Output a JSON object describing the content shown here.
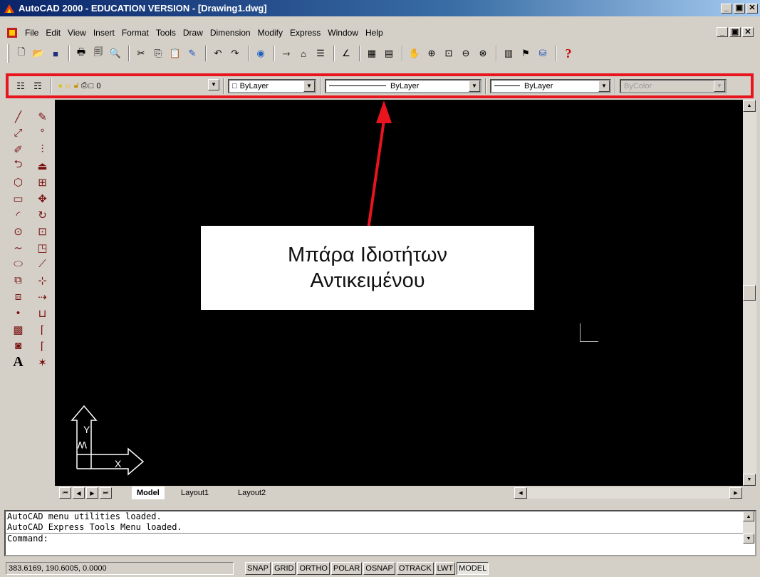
{
  "window": {
    "title": "AutoCAD 2000 - EDUCATION VERSION - [Drawing1.dwg]",
    "minimize": "_",
    "restore": "&#9635;",
    "close": "×"
  },
  "menu": [
    "File",
    "Edit",
    "View",
    "Insert",
    "Format",
    "Tools",
    "Draw",
    "Dimension",
    "Modify",
    "Express",
    "Window",
    "Help"
  ],
  "standard_toolbar": {
    "icons": [
      "new-icon",
      "open-icon",
      "save-icon",
      "print-icon",
      "print-preview-icon",
      "find-icon",
      "cut-icon",
      "copy-icon",
      "paste-icon",
      "match-properties-icon",
      "undo-icon",
      "redo-icon",
      "web-icon",
      "snap-from-icon",
      "block-icon",
      "properties-icon",
      "distance-icon",
      "design-center-icon",
      "adcenter-icon",
      "pan-icon",
      "zoom-realtime-icon",
      "zoom-window-icon",
      "zoom-previous-icon",
      "aerial-view-icon",
      "named-views-icon",
      "layer-icon",
      "help-icon"
    ],
    "help_glyph": "?"
  },
  "properties_bar": {
    "layer_value": "0",
    "color_value": "ByLayer",
    "linetype_value": "ByLayer",
    "lineweight_value": "ByLayer",
    "plotstyle_value": "ByColor"
  },
  "callout": {
    "line1": "Μπάρα Ιδιοτήτων",
    "line2": "Αντικειμένου",
    "arrow_color": "#e8141e"
  },
  "ucs": {
    "y_label": "Y",
    "w_label": "W",
    "x_label": "X"
  },
  "layout_tabs": [
    {
      "label": "Model",
      "active": true
    },
    {
      "label": "Layout1",
      "active": false
    },
    {
      "label": "Layout2",
      "active": false
    }
  ],
  "command_window": {
    "lines": [
      "AutoCAD menu utilities loaded.",
      "AutoCAD Express Tools Menu loaded."
    ],
    "prompt": "Command:"
  },
  "status": {
    "coordinates": "383.6169, 190.6005, 0.0000",
    "toggles": [
      {
        "label": "SNAP",
        "on": false
      },
      {
        "label": "GRID",
        "on": false
      },
      {
        "label": "ORTHO",
        "on": false
      },
      {
        "label": "POLAR",
        "on": false
      },
      {
        "label": "OSNAP",
        "on": false
      },
      {
        "label": "OTRACK",
        "on": false
      },
      {
        "label": "LWT",
        "on": false
      },
      {
        "label": "MODEL",
        "on": true
      }
    ]
  },
  "colors": {
    "title_gradient_start": "#0a246a",
    "highlight_border": "#e8141e",
    "canvas": "#000000"
  }
}
